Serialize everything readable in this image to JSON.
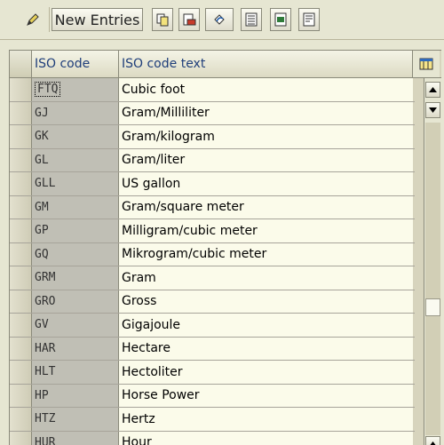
{
  "toolbar": {
    "new_entries_label": "New Entries",
    "buttons": [
      {
        "name": "edit-pencil-icon"
      },
      {
        "name": "copy-icon"
      },
      {
        "name": "delete-icon"
      },
      {
        "name": "undo-change-icon"
      },
      {
        "name": "select-all-icon"
      },
      {
        "name": "select-block-icon"
      },
      {
        "name": "deselect-all-icon"
      }
    ]
  },
  "table": {
    "columns": [
      "ISO code",
      "ISO code text"
    ],
    "rows": [
      {
        "code": "FTQ",
        "text": "Cubic foot"
      },
      {
        "code": "GJ",
        "text": "Gram/Milliliter"
      },
      {
        "code": "GK",
        "text": "Gram/kilogram"
      },
      {
        "code": "GL",
        "text": "Gram/liter"
      },
      {
        "code": "GLL",
        "text": "US gallon"
      },
      {
        "code": "GM",
        "text": "Gram/square meter"
      },
      {
        "code": "GP",
        "text": "Milligram/cubic meter"
      },
      {
        "code": "GQ",
        "text": "Mikrogram/cubic meter"
      },
      {
        "code": "GRM",
        "text": "Gram"
      },
      {
        "code": "GRO",
        "text": "Gross"
      },
      {
        "code": "GV",
        "text": "Gigajoule"
      },
      {
        "code": "HAR",
        "text": "Hectare"
      },
      {
        "code": "HLT",
        "text": "Hectoliter"
      },
      {
        "code": "HP",
        "text": "Horse Power"
      },
      {
        "code": "HTZ",
        "text": "Hertz"
      },
      {
        "code": "HUR",
        "text": "Hour"
      }
    ]
  },
  "colors": {
    "background": "#e6e6d2",
    "header_text": "#1f3e7a",
    "cell_bg": "#fbfbea",
    "code_bg": "#c0bfb5"
  }
}
